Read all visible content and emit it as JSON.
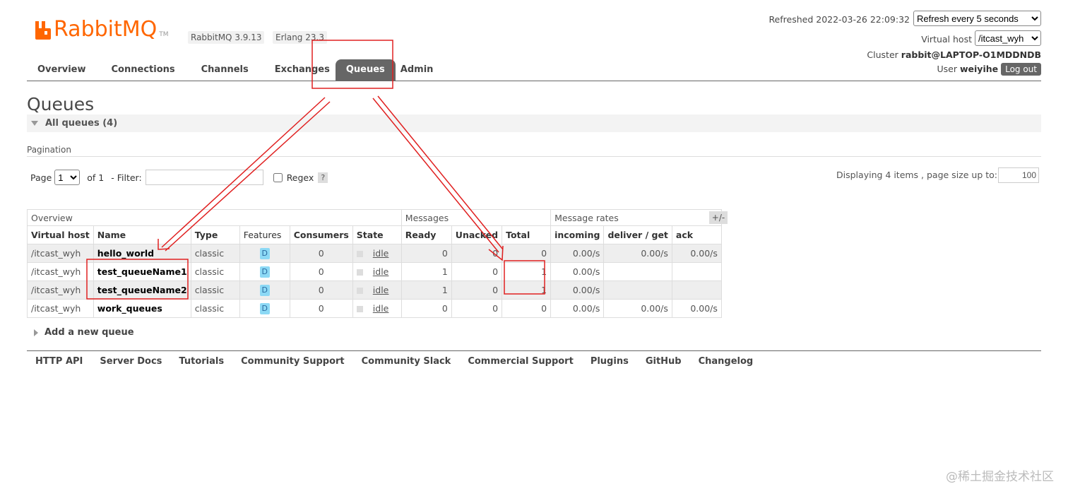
{
  "header": {
    "logo_text": "RabbitMQ",
    "logo_tm": "TM",
    "version_badge": "RabbitMQ 3.9.13",
    "erlang_badge": "Erlang 23.3",
    "refreshed_text": "Refreshed 2022-03-26 22:09:32",
    "refresh_select": "Refresh every 5 seconds",
    "vhost_label": "Virtual host",
    "vhost_select": "/itcast_wyh",
    "cluster_label": "Cluster",
    "cluster_name": "rabbit@LAPTOP-O1MDDNDB",
    "user_label": "User",
    "user_name": "weiyihe",
    "logout_label": "Log out"
  },
  "nav": {
    "items": [
      "Overview",
      "Connections",
      "Channels",
      "Exchanges",
      "Queues",
      "Admin"
    ],
    "active": "Queues"
  },
  "page": {
    "title": "Queues",
    "all_queues_label": "All queues (4)",
    "pagination_label": "Pagination"
  },
  "pager": {
    "page_label": "Page",
    "page_value": "1",
    "of_label": "of 1",
    "filter_label": "- Filter:",
    "filter_value": "",
    "regex_label": "Regex",
    "help_label": "?",
    "display_text": "Displaying 4 items , page size up to:",
    "page_size": "100"
  },
  "table": {
    "groups": [
      "Overview",
      "Messages",
      "Message rates"
    ],
    "toggle_label": "+/-",
    "headers": [
      "Virtual host",
      "Name",
      "Type",
      "Features",
      "Consumers",
      "State",
      "Ready",
      "Unacked",
      "Total",
      "incoming",
      "deliver / get",
      "ack"
    ],
    "rows": [
      {
        "vhost": "/itcast_wyh",
        "name": "hello_world",
        "type": "classic",
        "feature": "D",
        "consumers": "0",
        "state": "idle",
        "ready": "0",
        "unacked": "0",
        "total": "0",
        "incoming": "0.00/s",
        "deliver": "0.00/s",
        "ack": "0.00/s"
      },
      {
        "vhost": "/itcast_wyh",
        "name": "test_queueName1",
        "type": "classic",
        "feature": "D",
        "consumers": "0",
        "state": "idle",
        "ready": "1",
        "unacked": "0",
        "total": "1",
        "incoming": "0.00/s",
        "deliver": "",
        "ack": ""
      },
      {
        "vhost": "/itcast_wyh",
        "name": "test_queueName2",
        "type": "classic",
        "feature": "D",
        "consumers": "0",
        "state": "idle",
        "ready": "1",
        "unacked": "0",
        "total": "1",
        "incoming": "0.00/s",
        "deliver": "",
        "ack": ""
      },
      {
        "vhost": "/itcast_wyh",
        "name": "work_queues",
        "type": "classic",
        "feature": "D",
        "consumers": "0",
        "state": "idle",
        "ready": "0",
        "unacked": "0",
        "total": "0",
        "incoming": "0.00/s",
        "deliver": "0.00/s",
        "ack": "0.00/s"
      }
    ]
  },
  "add_queue_label": "Add a new queue",
  "footer": {
    "links": [
      "HTTP API",
      "Server Docs",
      "Tutorials",
      "Community Support",
      "Community Slack",
      "Commercial Support",
      "Plugins",
      "GitHub",
      "Changelog"
    ]
  },
  "watermark": "@稀土掘金技术社区",
  "colors": {
    "brand": "#ff6600",
    "annotation": "#e02020",
    "nav_active": "#666666"
  }
}
